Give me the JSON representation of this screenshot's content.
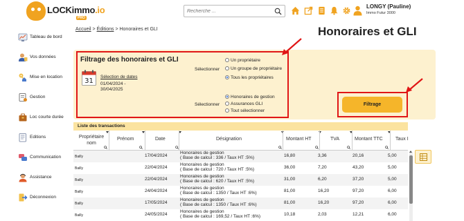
{
  "brand": {
    "logo_text": "LOCKimmo",
    "logo_suffix": ".io",
    "logo_badge": "PRO"
  },
  "search": {
    "placeholder": "Recherche ..."
  },
  "user": {
    "name": "LONGY (Pauline)",
    "company": "Immo Futur 3000"
  },
  "sidebar": {
    "items": [
      {
        "label": "Tableau de bord",
        "icon": "dashboard-icon"
      },
      {
        "label": "Vos données",
        "icon": "user-data-icon"
      },
      {
        "label": "Mise en location",
        "icon": "rental-icon"
      },
      {
        "label": "Gestion",
        "icon": "management-icon"
      },
      {
        "label": "Loc courte durée",
        "icon": "short-rental-icon"
      },
      {
        "label": "Editions",
        "icon": "editions-icon"
      },
      {
        "label": "Communication",
        "icon": "communication-icon"
      },
      {
        "label": "Assistance",
        "icon": "assistance-icon"
      },
      {
        "label": "Déconnexion",
        "icon": "logout-icon"
      }
    ]
  },
  "breadcrumb": {
    "home": "Accueil",
    "sep": ">",
    "editions": "Éditions",
    "current": "Honoraires et GLI"
  },
  "page_title": "Honoraires et GLI",
  "filter": {
    "title": "Filtrage des honoraires et GLI",
    "date_link": "Sélection de dates",
    "date_range": "01/04/2024 - 30/04/2025",
    "calendar_day": "31",
    "owner_select_label": "Sélectionner",
    "owner_options": [
      "Un propriétaire",
      "Un groupe de propriétaire",
      "Tous les propriétaires"
    ],
    "owner_selected": 2,
    "type_select_label": "Sélectionner",
    "type_options": [
      "Honoraires de gestion",
      "Assurances GLI",
      "Tout sélectionner"
    ],
    "type_selected": 0,
    "button_label": "Filtrage"
  },
  "transactions": {
    "title": "Liste des transactions",
    "columns": [
      "Propriétaire nom",
      "Prénom",
      "Date",
      "Désignation",
      "Montant HT",
      "TVA",
      "Montant TTC",
      "Taux I"
    ],
    "rows": [
      {
        "owner": "Bailly",
        "firstname": "",
        "date": "17/04/2024",
        "designation_1": "Honoraires de gestion",
        "designation_2": "( Base de calcul : 336 / Taux HT :5%)",
        "ht": "16,80",
        "tva": "3,36",
        "ttc": "20,16",
        "rate": "5,00"
      },
      {
        "owner": "Bailly",
        "firstname": "",
        "date": "22/04/2024",
        "designation_1": "Honoraires de gestion",
        "designation_2": "( Base de calcul : 720 / Taux HT :5%)",
        "ht": "36,00",
        "tva": "7,20",
        "ttc": "43,20",
        "rate": "5,00"
      },
      {
        "owner": "Bailly",
        "firstname": "",
        "date": "22/04/2024",
        "designation_1": "Honoraires de gestion",
        "designation_2": "( Base de calcul : 620 / Taux HT :5%)",
        "ht": "31,00",
        "tva": "6,20",
        "ttc": "37,20",
        "rate": "5,00"
      },
      {
        "owner": "Bailly",
        "firstname": "",
        "date": "24/04/2024",
        "designation_1": "Honoraires de gestion",
        "designation_2": "( Base de calcul : 1350 / Taux HT :6%)",
        "ht": "81,00",
        "tva": "16,20",
        "ttc": "97,20",
        "rate": "6,00"
      },
      {
        "owner": "Bailly",
        "firstname": "",
        "date": "17/05/2024",
        "designation_1": "Honoraires de gestion",
        "designation_2": "( Base de calcul : 1350 / Taux HT :6%)",
        "ht": "81,00",
        "tva": "16,20",
        "ttc": "97,20",
        "rate": "6,00"
      },
      {
        "owner": "Bailly",
        "firstname": "",
        "date": "24/05/2024",
        "designation_1": "Honoraires de gestion",
        "designation_2": "( Base de calcul : 169,52 / Taux HT :6%)",
        "ht": "10,18",
        "tva": "2,03",
        "ttc": "12,21",
        "rate": "6,00"
      }
    ]
  },
  "colors": {
    "accent": "#f5b52a",
    "panel": "#fdf1cf",
    "highlight": "#e01515",
    "nav_icons": "#f0a320"
  }
}
